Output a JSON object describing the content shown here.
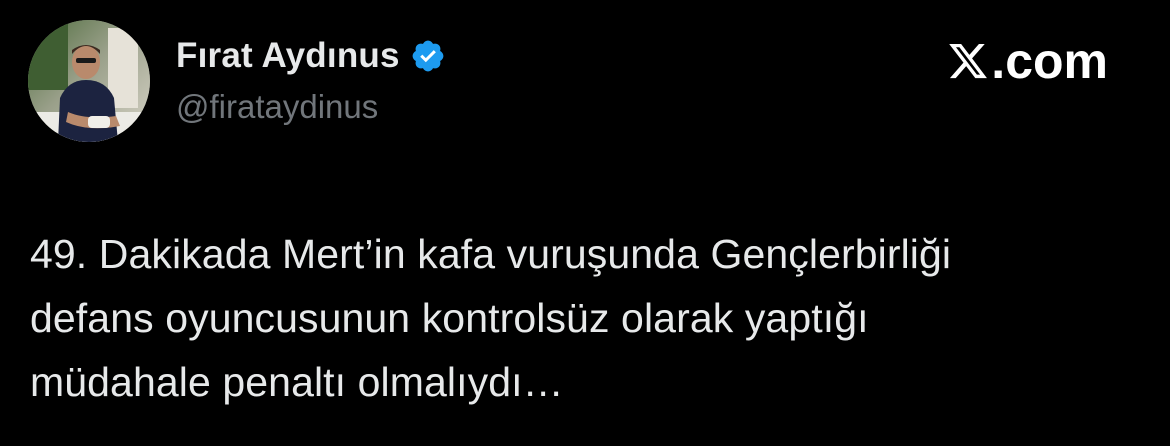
{
  "author": {
    "display_name": "Fırat Aydınus",
    "handle": "@firataydinus",
    "verified": true,
    "verified_color": "#1d9bf0",
    "avatar": "profile-photo"
  },
  "brand": {
    "label": ".com",
    "logo_icon": "x-logo-icon"
  },
  "tweet": {
    "lines": [
      "49. Dakikada Mert’in kafa vuruşunda Gençlerbirliği",
      "defans oyuncusunun kontrolsüz olarak yaptığı",
      "müdahale penaltı olmalıydı…"
    ]
  },
  "colors": {
    "background": "#000000",
    "text_primary": "#e7e9ea",
    "text_secondary": "#71767b"
  }
}
